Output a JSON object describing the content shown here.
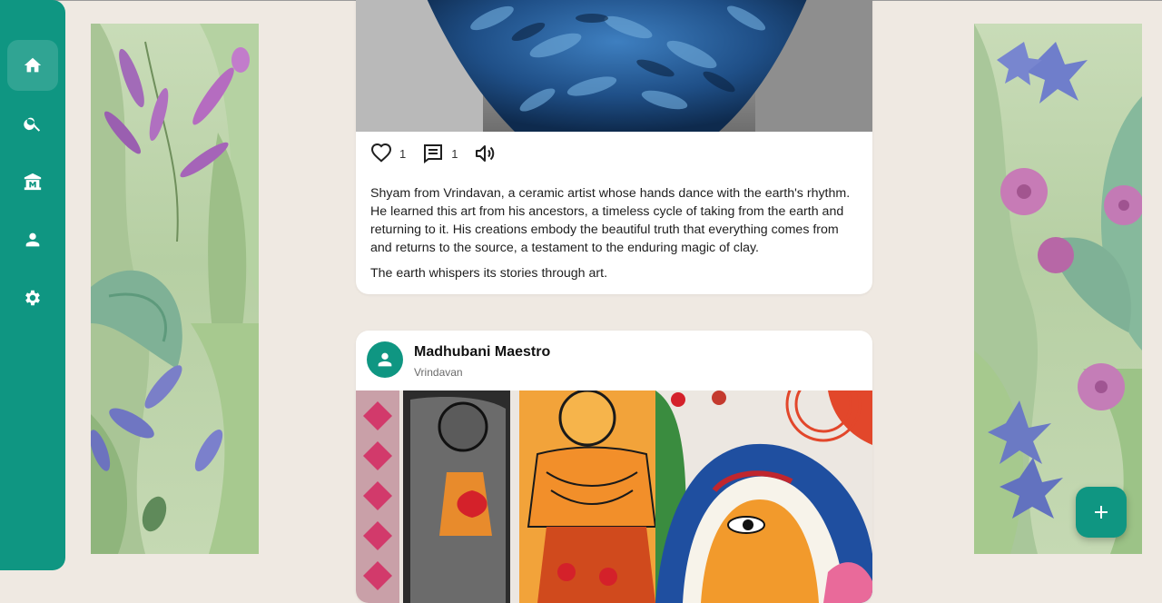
{
  "nav": {
    "items": [
      {
        "name": "home",
        "icon": "home-icon",
        "active": true
      },
      {
        "name": "search",
        "icon": "search-icon",
        "active": false
      },
      {
        "name": "museum",
        "icon": "museum-icon",
        "active": false
      },
      {
        "name": "profile",
        "icon": "person-icon",
        "active": false
      },
      {
        "name": "settings",
        "icon": "gear-icon",
        "active": false
      }
    ]
  },
  "posts": [
    {
      "image": "blue-ceramic-vase",
      "likes": "1",
      "comments": "1",
      "audio_icon": "speaker-icon",
      "paragraphs": [
        "Shyam from Vrindavan, a ceramic artist whose hands dance with the earth's rhythm. He learned this art from his ancestors, a timeless cycle of taking from the earth and returning to it. His creations embody the beautiful truth that everything comes from and returns to the source, a testament to the enduring magic of clay.",
        "The earth whispers its stories through art."
      ]
    },
    {
      "author": "Madhubani Maestro",
      "location": "Vrindavan",
      "image": "madhubani-painting"
    }
  ],
  "fab": {
    "icon": "add-icon"
  },
  "colors": {
    "accent": "#0f9682",
    "background": "#efe9e2",
    "card": "#ffffff"
  }
}
